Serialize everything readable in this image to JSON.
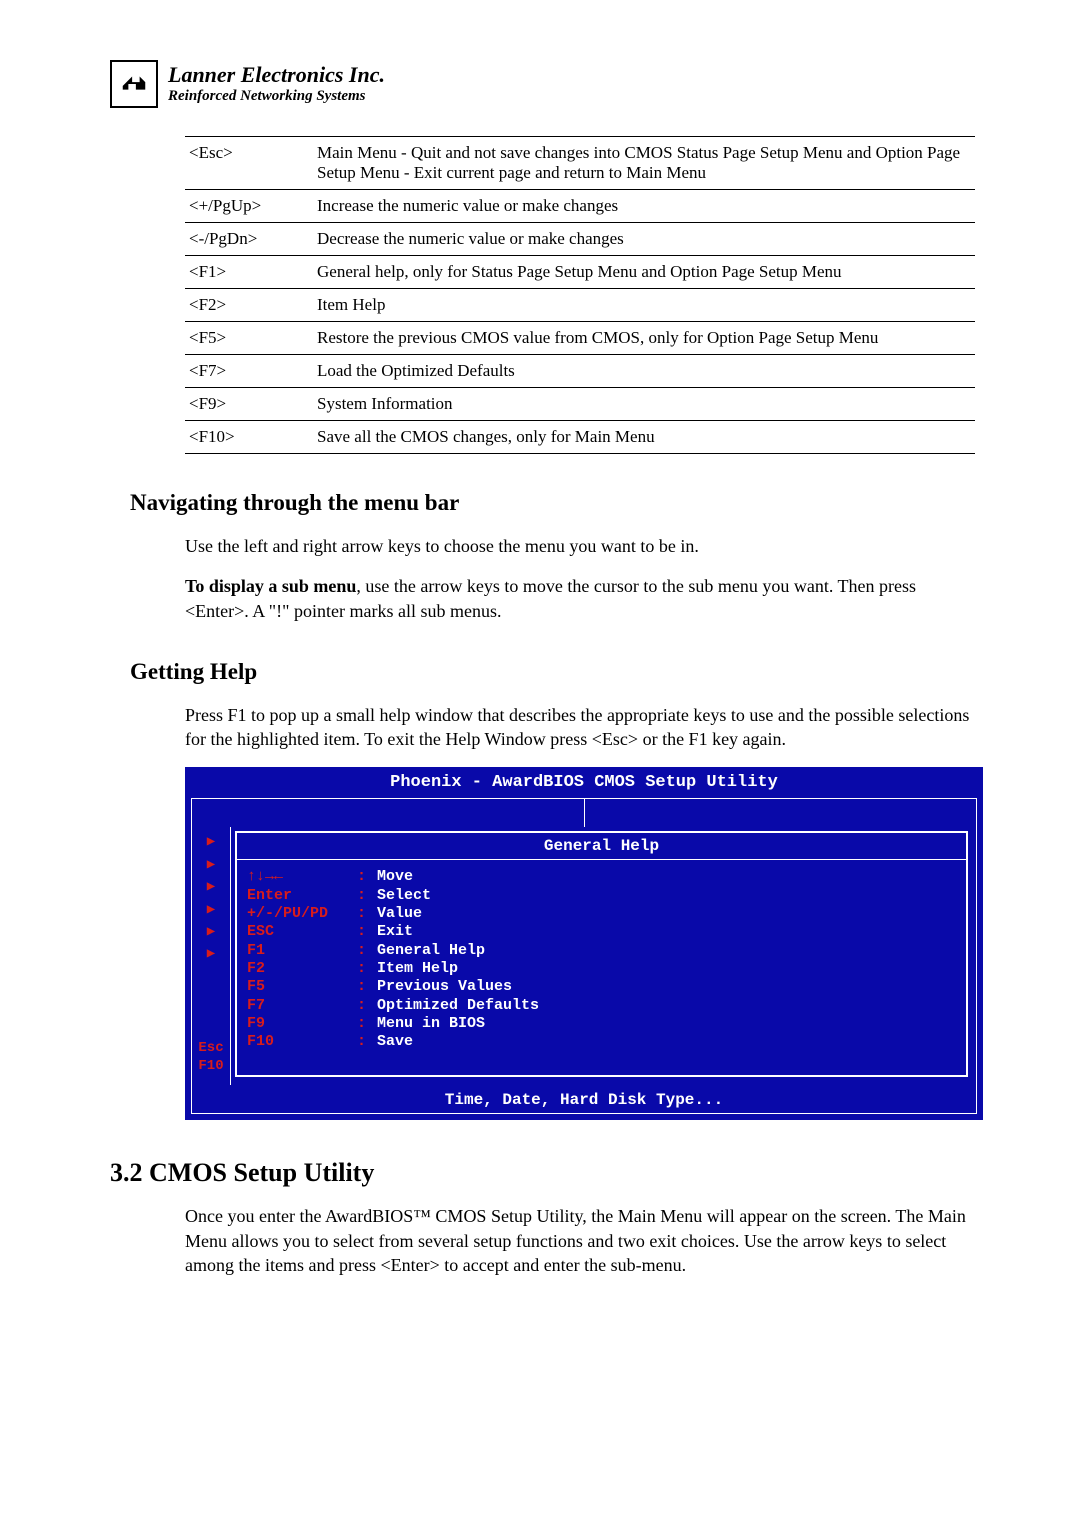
{
  "header": {
    "company": "Lanner Electronics Inc.",
    "tagline": "Reinforced Networking Systems"
  },
  "key_table": [
    {
      "key": "<Esc>",
      "desc": "Main Menu - Quit and not save changes into CMOS Status Page Setup Menu and Option Page Setup Menu - Exit current page and return to Main Menu"
    },
    {
      "key": "<+/PgUp>",
      "desc": "Increase the numeric value or make changes"
    },
    {
      "key": "<-/PgDn>",
      "desc": "Decrease the numeric value or make changes"
    },
    {
      "key": "<F1>",
      "desc": "General help, only for Status Page Setup Menu and Option Page Setup Menu"
    },
    {
      "key": "<F2>",
      "desc": "Item Help"
    },
    {
      "key": "<F5>",
      "desc": "Restore the previous CMOS value from CMOS, only for Option Page Setup Menu"
    },
    {
      "key": "<F7>",
      "desc": "Load the Optimized Defaults"
    },
    {
      "key": "<F9>",
      "desc": "System Information"
    },
    {
      "key": "<F10>",
      "desc": "Save all the CMOS changes, only for Main Menu"
    }
  ],
  "sections": {
    "nav_heading": "Navigating through the menu bar",
    "nav_p1": "Use the left and right arrow keys to choose the menu you want to be in.",
    "nav_p2_bold": "To display a sub menu",
    "nav_p2_rest": ", use the arrow keys to move the cursor to the sub menu you want. Then press <Enter>. A \"!\" pointer marks all sub menus.",
    "help_heading": "Getting Help",
    "help_p": "Press F1 to pop up a small help window that describes the appropriate keys to use and the possible selections for the highlighted item. To exit the Help Window press <Esc> or the F1 key again.",
    "cmos_heading": "3.2  CMOS Setup Utility",
    "cmos_p": "Once you enter the AwardBIOS™ CMOS Setup Utility, the Main Menu will appear on the screen. The Main Menu allows you to select from several setup functions and two exit choices. Use the arrow keys to select among the items and press <Enter> to accept and enter the sub-menu."
  },
  "bios": {
    "title": "Phoenix - AwardBIOS CMOS Setup Utility",
    "help_title": "General Help",
    "items": [
      {
        "k": "↑↓→←",
        "d": "Move"
      },
      {
        "k": "Enter",
        "d": "Select"
      },
      {
        "k": "+/-/PU/PD",
        "d": "Value"
      },
      {
        "k": "ESC",
        "d": "Exit"
      },
      {
        "k": "F1",
        "d": "General Help"
      },
      {
        "k": "F2",
        "d": "Item Help"
      },
      {
        "k": "F5",
        "d": "Previous Values"
      },
      {
        "k": "F7",
        "d": "Optimized Defaults"
      },
      {
        "k": "F9",
        "d": "Menu in BIOS"
      },
      {
        "k": "F10",
        "d": "Save"
      }
    ],
    "esc_label": "Esc",
    "f10_label": "F10",
    "footer": "Time, Date, Hard Disk Type..."
  }
}
